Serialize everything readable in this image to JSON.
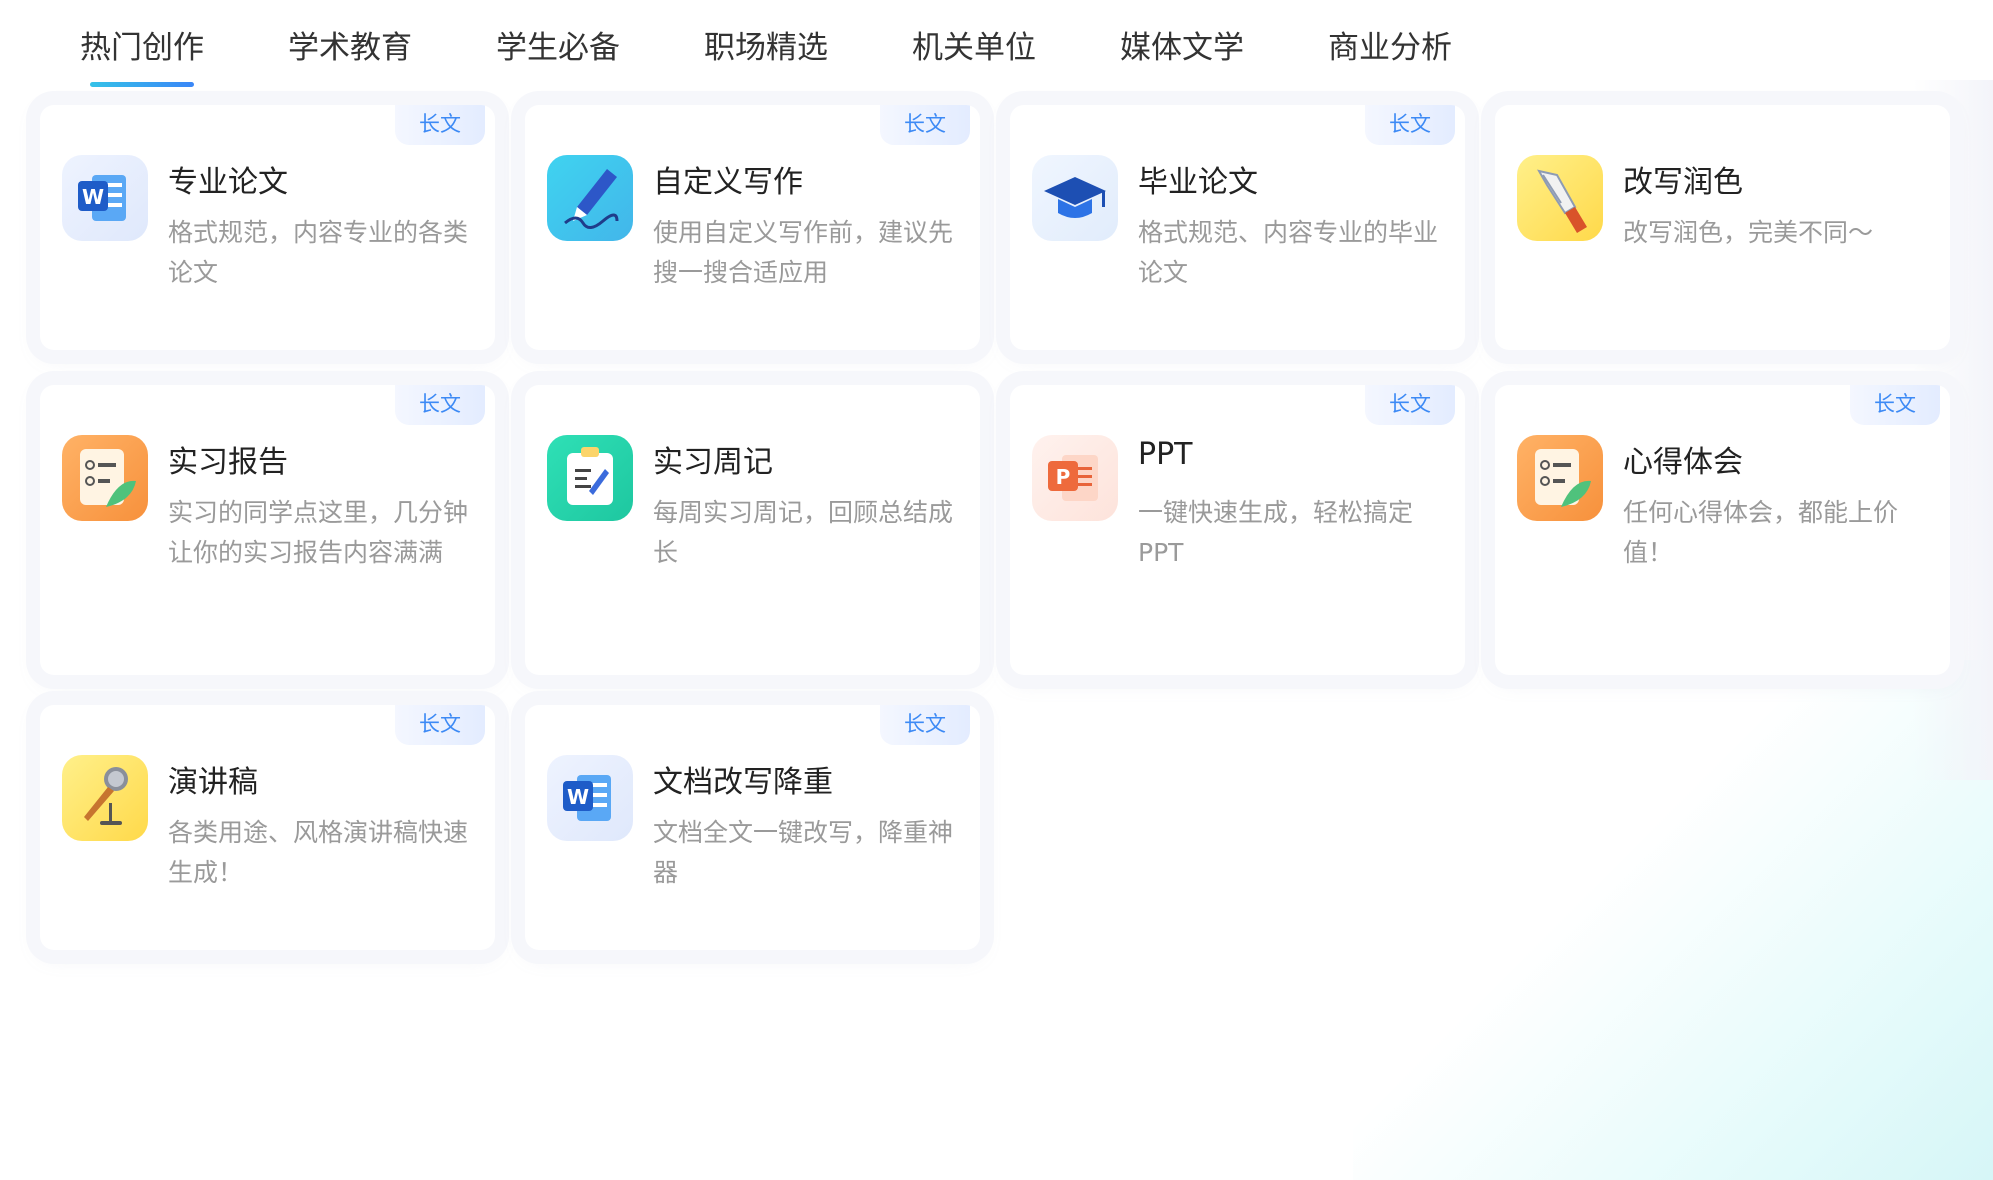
{
  "tabs": [
    {
      "label": "热门创作",
      "active": true
    },
    {
      "label": "学术教育",
      "active": false
    },
    {
      "label": "学生必备",
      "active": false
    },
    {
      "label": "职场精选",
      "active": false
    },
    {
      "label": "机关单位",
      "active": false
    },
    {
      "label": "媒体文学",
      "active": false
    },
    {
      "label": "商业分析",
      "active": false
    }
  ],
  "cards": [
    {
      "title": "专业论文",
      "desc": "格式规范，内容专业的各类论文",
      "tag": "长文",
      "icon": "word-doc-icon"
    },
    {
      "title": "自定义写作",
      "desc": "使用自定义写作前，建议先搜一搜合适应用",
      "tag": "长文",
      "icon": "pen-signature-icon"
    },
    {
      "title": "毕业论文",
      "desc": "格式规范、内容专业的毕业论文",
      "tag": "长文",
      "icon": "graduation-cap-icon"
    },
    {
      "title": "改写润色",
      "desc": "改写润色，完美不同～",
      "tag": "",
      "icon": "fountain-pen-icon"
    },
    {
      "title": "实习报告",
      "desc": "实习的同学点这里，几分钟让你的实习报告内容满满",
      "tag": "长文",
      "icon": "report-scroll-icon"
    },
    {
      "title": "实习周记",
      "desc": "每周实习周记，回顾总结成长",
      "tag": "",
      "icon": "clipboard-icon"
    },
    {
      "title": "PPT",
      "desc": "一键快速生成，轻松搞定PPT",
      "tag": "长文",
      "icon": "ppt-icon"
    },
    {
      "title": "心得体会",
      "desc": "任何心得体会，都能上价值！",
      "tag": "长文",
      "icon": "report-scroll-icon"
    },
    {
      "title": "演讲稿",
      "desc": "各类用途、风格演讲稿快速生成！",
      "tag": "长文",
      "icon": "microphone-icon"
    },
    {
      "title": "文档改写降重",
      "desc": "文档全文一键改写，降重神器",
      "tag": "长文",
      "icon": "word-doc-icon"
    }
  ]
}
